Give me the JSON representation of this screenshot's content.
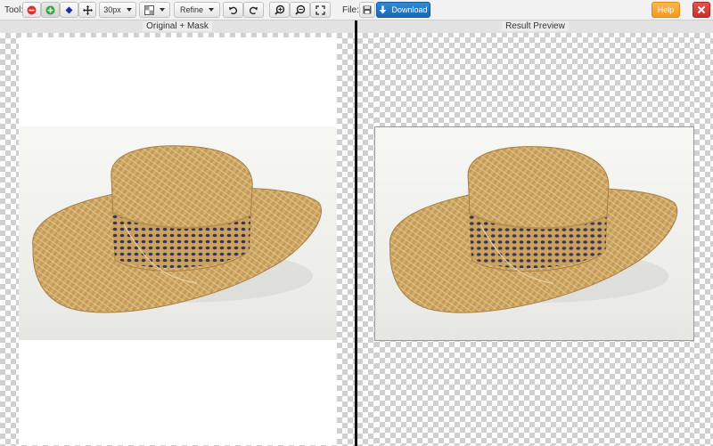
{
  "toolbar": {
    "tool_label": "Tool:",
    "brush_size": "30px",
    "refine_label": "Refine",
    "file_label": "File:",
    "download_label": "Download",
    "help_label": "Help"
  },
  "panels": {
    "left_title": "Original + Mask",
    "right_title": "Result Preview"
  },
  "icons": {
    "remove": "minus-circle-icon",
    "keep": "plus-circle-icon",
    "hair": "diamond-icon",
    "pan": "move-icon",
    "view": "view-mode-icon",
    "undo": "undo-icon",
    "redo": "redo-icon",
    "zoom_in": "zoom-in-icon",
    "zoom_out": "zoom-out-icon",
    "fit": "fit-screen-icon",
    "save": "save-icon",
    "download": "download-arrow-icon",
    "close": "close-icon"
  },
  "colors": {
    "remove_red": "#d9342b",
    "keep_green": "#2fa43a",
    "hair_blue": "#1b2fa3",
    "download_blue": "#1f76c7",
    "help_orange": "#f7a43a",
    "close_red": "#d43f3a"
  }
}
